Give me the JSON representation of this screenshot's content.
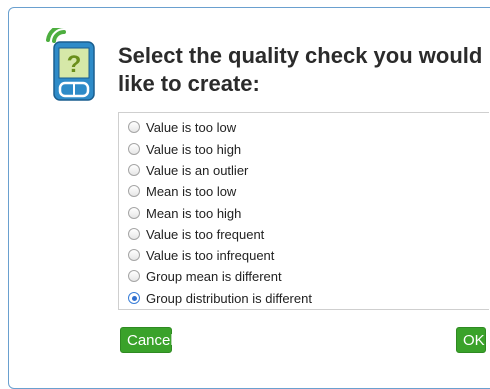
{
  "dialog": {
    "title": "Select the quality check you would like to create:"
  },
  "options": [
    {
      "label": "Value is too low",
      "selected": false
    },
    {
      "label": "Value is too high",
      "selected": false
    },
    {
      "label": "Value is an outlier",
      "selected": false
    },
    {
      "label": "Mean is too low",
      "selected": false
    },
    {
      "label": "Mean is too high",
      "selected": false
    },
    {
      "label": "Value is too frequent",
      "selected": false
    },
    {
      "label": "Value is too infrequent",
      "selected": false
    },
    {
      "label": "Group mean is different",
      "selected": false
    },
    {
      "label": "Group distribution is different",
      "selected": true
    }
  ],
  "buttons": {
    "cancel": "Cancel",
    "ok": "OK"
  },
  "colors": {
    "button_green": "#3aa22a",
    "frame_blue": "#6aa0cf",
    "radio_selected": "#2f6fd0"
  },
  "icons": {
    "app": "phone-question-icon"
  }
}
